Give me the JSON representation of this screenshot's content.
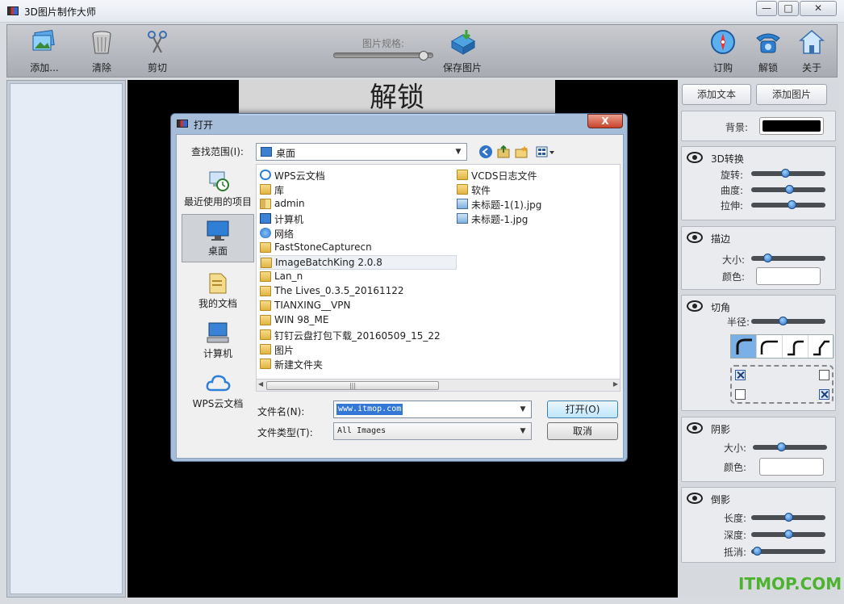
{
  "window": {
    "title": "3D图片制作大师",
    "controls": {
      "minimize": "—",
      "maximize": "□",
      "close": "✕"
    }
  },
  "toolbar": {
    "add": "添加...",
    "clear": "清除",
    "cut": "剪切",
    "spec_label": "图片规格:",
    "spec_value": 0.95,
    "save": "保存图片",
    "order": "订购",
    "unlock": "解锁",
    "about": "关于"
  },
  "preview": {
    "title": "解锁"
  },
  "right_panel": {
    "add_text": "添加文本",
    "add_image": "添加图片",
    "background": {
      "label": "背景:",
      "color": "#000000"
    },
    "transform": {
      "title": "3D转换",
      "rotate_label": "旋转:",
      "rotate": 0.46,
      "curve_label": "曲度:",
      "curve": 0.52,
      "stretch_label": "拉伸:",
      "stretch": 0.55
    },
    "stroke": {
      "title": "描边",
      "size_label": "大小:",
      "size": 0.18,
      "color_label": "颜色:",
      "color": "#ffffff"
    },
    "corner": {
      "title": "切角",
      "radius_label": "半径:",
      "radius": 0.42,
      "styles": [
        "round-solid",
        "round",
        "step-curve",
        "step"
      ],
      "selected_style": 0,
      "corners": {
        "top_left": true,
        "top_right": false,
        "bottom_left": false,
        "bottom_right": true
      }
    },
    "shadow": {
      "title": "阴影",
      "size_label": "大小:",
      "size": 0.37,
      "color_label": "颜色:",
      "color": "#ffffff"
    },
    "reflection": {
      "title": "倒影",
      "length_label": "长度:",
      "length": 0.51,
      "depth_label": "深度:",
      "depth": 0.51,
      "fade_label": "抵消:",
      "fade": 0.02
    }
  },
  "watermark": "ITMOP.COM",
  "dialog": {
    "title": "打开",
    "close": "X",
    "look_in_label": "查找范围(I):",
    "look_in_value": "桌面",
    "places": [
      {
        "label": "最近使用的项目",
        "icon": "recent-items-icon"
      },
      {
        "label": "桌面",
        "icon": "desktop-icon",
        "selected": true
      },
      {
        "label": "我的文档",
        "icon": "my-documents-icon"
      },
      {
        "label": "计算机",
        "icon": "computer-icon"
      },
      {
        "label": "WPS云文档",
        "icon": "wps-cloud-icon"
      }
    ],
    "files_col1": [
      {
        "name": "WPS云文档",
        "icon": "cloud-icon"
      },
      {
        "name": "库",
        "icon": "library-icon"
      },
      {
        "name": "admin",
        "icon": "user-folder-icon"
      },
      {
        "name": "计算机",
        "icon": "computer-icon"
      },
      {
        "name": "网络",
        "icon": "network-icon"
      },
      {
        "name": "FastStoneCapturecn",
        "icon": "folder-icon"
      },
      {
        "name": "ImageBatchKing 2.0.8",
        "icon": "folder-icon",
        "hover": true
      },
      {
        "name": "Lan_n",
        "icon": "folder-icon"
      },
      {
        "name": "The Lives_0.3.5_20161122",
        "icon": "folder-icon"
      },
      {
        "name": "TIANXING__VPN",
        "icon": "folder-icon"
      },
      {
        "name": "WIN 98_ME",
        "icon": "folder-icon"
      },
      {
        "name": "钉钉云盘打包下载_20160509_15_22",
        "icon": "folder-icon"
      },
      {
        "name": "图片",
        "icon": "folder-icon"
      },
      {
        "name": "新建文件夹",
        "icon": "folder-icon"
      }
    ],
    "files_col2": [
      {
        "name": "VCDS日志文件",
        "icon": "shortcut-folder-icon"
      },
      {
        "name": "软件",
        "icon": "shortcut-folder-icon"
      },
      {
        "name": "未标题-1(1).jpg",
        "icon": "image-file-icon"
      },
      {
        "name": "未标题-1.jpg",
        "icon": "image-file-icon"
      }
    ],
    "filename_label": "文件名(N):",
    "filename_value": "www.itmop.com",
    "filetype_label": "文件类型(T):",
    "filetype_value": "All Images",
    "open_button": "打开(O)",
    "cancel_button": "取消"
  }
}
